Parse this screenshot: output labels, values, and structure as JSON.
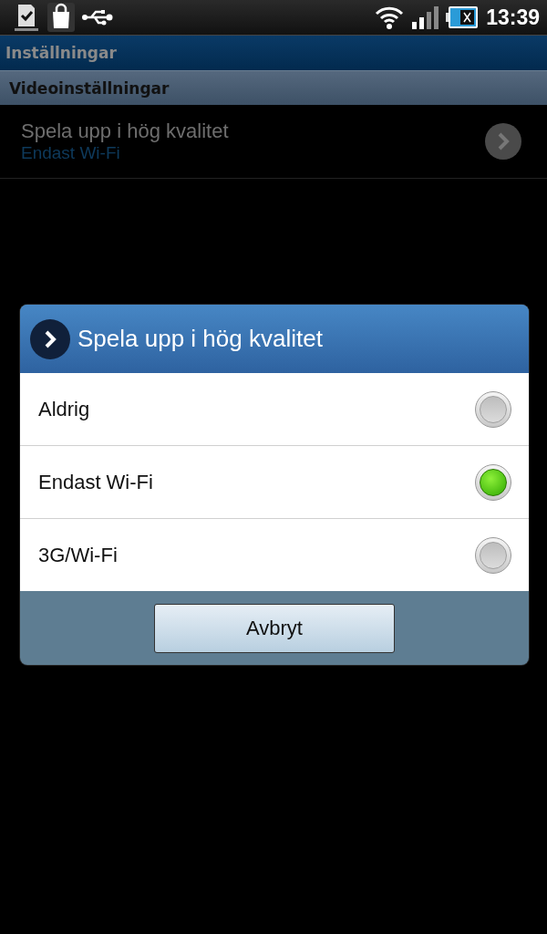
{
  "status_bar": {
    "time": "13:39"
  },
  "title_bar": {
    "title": "Inställningar"
  },
  "section": {
    "title": "Videoinställningar"
  },
  "setting": {
    "title": "Spela upp i hög kvalitet",
    "value": "Endast Wi-Fi"
  },
  "dialog": {
    "title": "Spela upp i hög kvalitet",
    "options": [
      {
        "label": "Aldrig",
        "selected": false
      },
      {
        "label": "Endast Wi-Fi",
        "selected": true
      },
      {
        "label": "3G/Wi-Fi",
        "selected": false
      }
    ],
    "cancel": "Avbryt"
  }
}
